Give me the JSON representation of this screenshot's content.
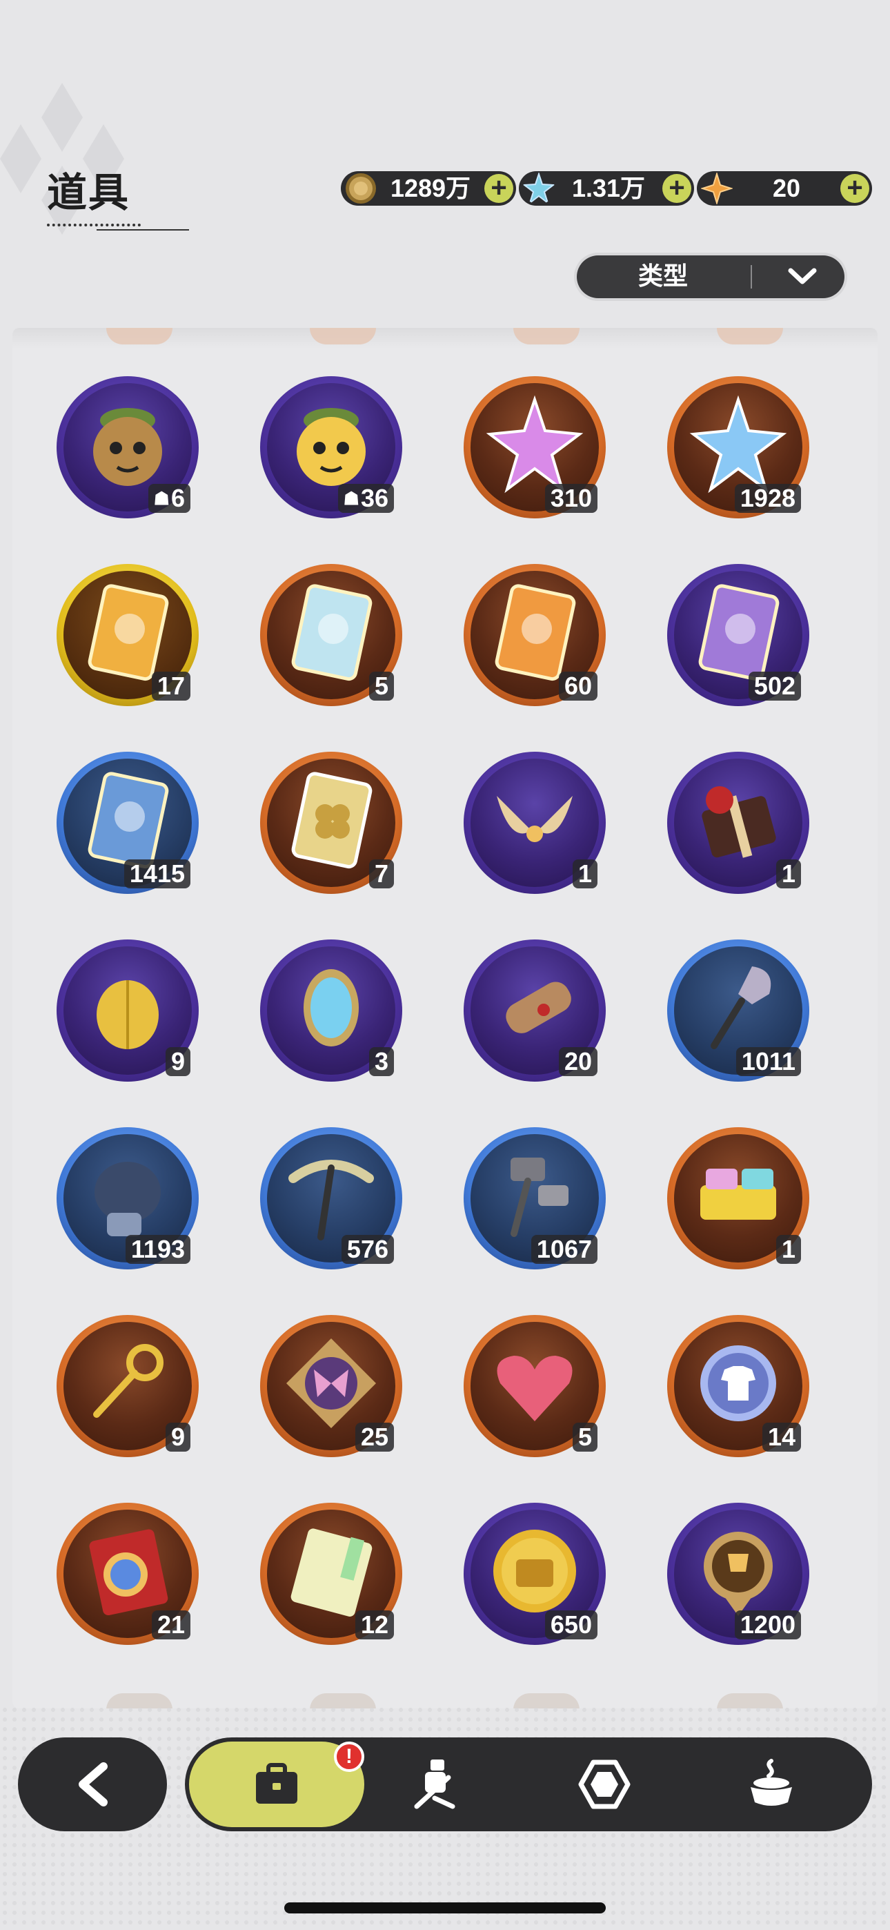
{
  "header": {
    "title": "道具"
  },
  "currencies": [
    {
      "name": "gold-coin",
      "value": "1289万",
      "color": "#c8a45a"
    },
    {
      "name": "crystal",
      "value": "1.31万",
      "color": "#7fd0e8"
    },
    {
      "name": "star-shard",
      "value": "20",
      "color": "#f0a040"
    }
  ],
  "currency_plus": "+",
  "filter": {
    "label": "类型"
  },
  "items": [
    {
      "icon": "plant-creature-dark-icon",
      "count": "6",
      "shared": true,
      "rarity": "purple"
    },
    {
      "icon": "plant-creature-yellow-icon",
      "count": "36",
      "shared": true,
      "rarity": "purple"
    },
    {
      "icon": "pink-star-crystal-icon",
      "count": "310",
      "rarity": "orange"
    },
    {
      "icon": "blue-star-crystal-icon",
      "count": "1928",
      "rarity": "orange"
    },
    {
      "icon": "golden-character-card-icon",
      "count": "17",
      "rarity": "gold"
    },
    {
      "icon": "holo-character-card-icon",
      "count": "5",
      "rarity": "orange"
    },
    {
      "icon": "orange-character-card-icon",
      "count": "60",
      "rarity": "orange"
    },
    {
      "icon": "purple-character-card-icon",
      "count": "502",
      "rarity": "purple"
    },
    {
      "icon": "blue-character-card-icon",
      "count": "1415",
      "rarity": "blue"
    },
    {
      "icon": "clover-card-icon",
      "count": "7",
      "rarity": "orange"
    },
    {
      "icon": "golden-horns-icon",
      "count": "1",
      "rarity": "purple"
    },
    {
      "icon": "gift-box-icon",
      "count": "1",
      "rarity": "purple"
    },
    {
      "icon": "golden-shell-icon",
      "count": "9",
      "rarity": "purple"
    },
    {
      "icon": "magic-mirror-icon",
      "count": "3",
      "rarity": "purple"
    },
    {
      "icon": "scroll-icon",
      "count": "20",
      "rarity": "purple"
    },
    {
      "icon": "shovel-icon",
      "count": "1011",
      "rarity": "blue"
    },
    {
      "icon": "boxing-glove-icon",
      "count": "1193",
      "rarity": "blue"
    },
    {
      "icon": "pickaxe-icon",
      "count": "576",
      "rarity": "blue"
    },
    {
      "icon": "hammer-icon",
      "count": "1067",
      "rarity": "blue"
    },
    {
      "icon": "building-block-icon",
      "count": "1",
      "rarity": "orange"
    },
    {
      "icon": "golden-key-icon",
      "count": "9",
      "rarity": "orange"
    },
    {
      "icon": "butterfly-emblem-icon",
      "count": "25",
      "rarity": "orange"
    },
    {
      "icon": "heart-gem-icon",
      "count": "5",
      "rarity": "orange"
    },
    {
      "icon": "shirt-token-icon",
      "count": "14",
      "rarity": "orange"
    },
    {
      "icon": "wheel-ticket-icon",
      "count": "21",
      "rarity": "orange"
    },
    {
      "icon": "rainbow-ticket-icon",
      "count": "12",
      "rarity": "orange"
    },
    {
      "icon": "suitcase-coin-icon",
      "count": "650",
      "rarity": "purple"
    },
    {
      "icon": "trophy-medal-icon",
      "count": "1200",
      "rarity": "purple"
    }
  ],
  "nav": {
    "alert_badge": "!",
    "tabs": [
      {
        "name": "bag-icon",
        "active": true
      },
      {
        "name": "fighter-icon",
        "active": false
      },
      {
        "name": "gem-icon",
        "active": false
      },
      {
        "name": "cauldron-icon",
        "active": false
      }
    ]
  }
}
